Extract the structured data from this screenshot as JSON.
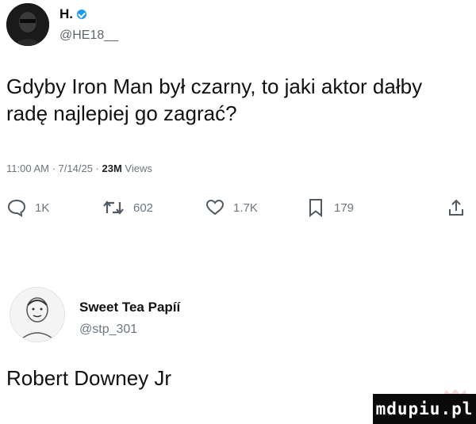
{
  "author": {
    "name": "H.",
    "handle": "@HE18__"
  },
  "tweet": {
    "text": "Gdyby Iron Man był czarny, to jaki aktor dałby radę najlepiej go zagrać?",
    "time": "11:00 AM",
    "date": "7/14/25",
    "views_count": "23M",
    "views_label": "Views"
  },
  "actions": {
    "replies": "1K",
    "retweets": "602",
    "likes": "1.7K",
    "bookmarks": "179"
  },
  "reply": {
    "name": "Sweet Tea Papíí",
    "handle": "@stp_301",
    "text": "Robert Downey Jr"
  },
  "watermark": {
    "text": "mdupiu.pl"
  },
  "colors": {
    "verified": "#1d9bf0",
    "meta_text": "#6b7680"
  }
}
